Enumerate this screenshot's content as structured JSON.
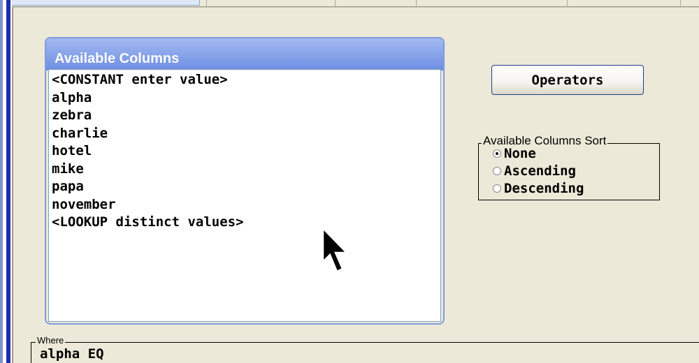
{
  "available_columns": {
    "title": "Available Columns",
    "items": [
      "<CONSTANT enter value>",
      "alpha",
      "zebra",
      "charlie",
      "hotel",
      "mike",
      "papa",
      "november",
      "<LOOKUP distinct values>"
    ]
  },
  "operators_button": {
    "label": "Operators"
  },
  "sort": {
    "legend": "Available Columns Sort",
    "options": [
      "None",
      "Ascending",
      "Descending"
    ],
    "selected": "None"
  },
  "where": {
    "legend": "Where",
    "value": "alpha EQ"
  },
  "colors": {
    "group_header": "#6d8ee2",
    "panel_bg": "#ece9d8",
    "button_border": "#1c3c8c"
  },
  "icons": [
    "mouse-pointer-icon",
    "radio-icon"
  ]
}
